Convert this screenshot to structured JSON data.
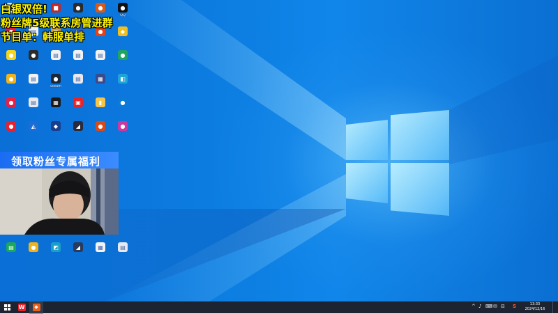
{
  "overlay": {
    "line1": "白银双倍!",
    "line2": "粉丝牌5级联系房管进群",
    "line3": "节目单：韩服单排",
    "banner": "领取粉丝专属福利"
  },
  "desktop_icons": [
    {
      "label": "",
      "color": "#e8e8ee",
      "glyph": "▤"
    },
    {
      "label": "",
      "color": "#3a5aa8",
      "glyph": "◆"
    },
    {
      "label": "",
      "color": "#c0282a",
      "glyph": "■"
    },
    {
      "label": "",
      "color": "#2b2b2b",
      "glyph": "●"
    },
    {
      "label": "",
      "color": "#d65a1a",
      "glyph": "●"
    },
    {
      "label": "QQ",
      "color": "#111111",
      "glyph": "●"
    },
    {
      "label": "",
      "color": "#e21d48",
      "glyph": "●"
    },
    {
      "label": "",
      "color": "#f2f2f2",
      "glyph": "▤"
    },
    {
      "label": "",
      "color": "#d8a23a",
      "glyph": "▦"
    },
    {
      "label": "",
      "color": "#1e64c8",
      "glyph": "◣"
    },
    {
      "label": "",
      "color": "#e84118",
      "glyph": "●"
    },
    {
      "label": "",
      "color": "#f0c020",
      "glyph": "◆"
    },
    {
      "label": "",
      "color": "#f5d41a",
      "glyph": "●"
    },
    {
      "label": "",
      "color": "#2b2b2b",
      "glyph": "●"
    },
    {
      "label": "",
      "color": "#f2f2f2",
      "glyph": "▤"
    },
    {
      "label": "",
      "color": "#f2f2f2",
      "glyph": "▤"
    },
    {
      "label": "",
      "color": "#f2f2f2",
      "glyph": "▤"
    },
    {
      "label": "",
      "color": "#1fa463",
      "glyph": "●"
    },
    {
      "label": "",
      "color": "#f0b41a",
      "glyph": "●"
    },
    {
      "label": "",
      "color": "#f2f2f2",
      "glyph": "▤"
    },
    {
      "label": "Steam",
      "color": "#1b2838",
      "glyph": "●"
    },
    {
      "label": "",
      "color": "#e8e8ee",
      "glyph": "▤"
    },
    {
      "label": "",
      "color": "#3a4a8a",
      "glyph": "▦"
    },
    {
      "label": "",
      "color": "#1fa4d8",
      "glyph": "◧"
    },
    {
      "label": "",
      "color": "#e82048",
      "glyph": "●"
    },
    {
      "label": "",
      "color": "#e8e8ee",
      "glyph": "▤"
    },
    {
      "label": "",
      "color": "#1a1a1a",
      "glyph": "▦"
    },
    {
      "label": "",
      "color": "#e8242a",
      "glyph": "▣"
    },
    {
      "label": "",
      "color": "#f3c64a",
      "glyph": "▮"
    },
    {
      "label": "",
      "color": "#0c7bd8",
      "glyph": "●"
    },
    {
      "label": "",
      "color": "#e82030",
      "glyph": "●"
    },
    {
      "label": "",
      "color": "#1c6ed6",
      "glyph": "◭"
    },
    {
      "label": "",
      "color": "#1a3f8a",
      "glyph": "◆"
    },
    {
      "label": "",
      "color": "#2a2a3a",
      "glyph": "◢"
    },
    {
      "label": "",
      "color": "#d84a1a",
      "glyph": "●"
    },
    {
      "label": "",
      "color": "#c83aa0",
      "glyph": "●"
    },
    {
      "label": "",
      "color": "#1aa85a",
      "glyph": "▤"
    },
    {
      "label": "",
      "color": "#f0b41a",
      "glyph": "●"
    },
    {
      "label": "",
      "color": "#1aa0c8",
      "glyph": "◩"
    },
    {
      "label": "",
      "color": "#2a3a5a",
      "glyph": "◢"
    },
    {
      "label": "",
      "color": "#f2f2f2",
      "glyph": "▦"
    },
    {
      "label": "",
      "color": "#e8e8ee",
      "glyph": "▤"
    }
  ],
  "taskbar": {
    "start_icon": "windows-start-icon",
    "apps": [
      {
        "name": "wps-icon",
        "color": "#e8242a",
        "glyph": "W"
      },
      {
        "name": "app-icon",
        "color": "#e8601a",
        "glyph": "◆"
      }
    ],
    "tray_glyphs": [
      "^",
      "♪",
      "⌨",
      "✉",
      "⊟",
      "S"
    ],
    "time": "13:33",
    "date": "2024/12/16"
  }
}
